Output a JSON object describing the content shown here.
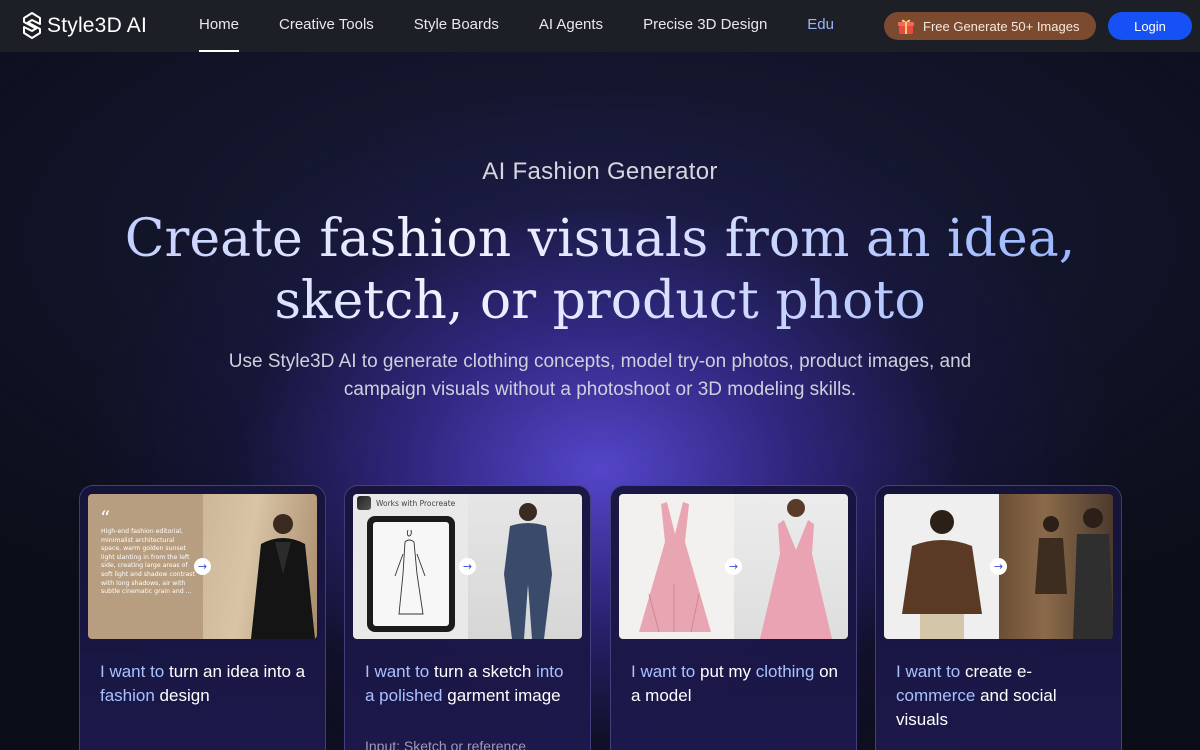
{
  "nav": {
    "logo_text": "Style3D AI",
    "links": [
      {
        "label": "Home",
        "active": true
      },
      {
        "label": "Creative Tools"
      },
      {
        "label": "Style Boards"
      },
      {
        "label": "AI Agents"
      },
      {
        "label": "Precise 3D Design"
      },
      {
        "label": "Edu"
      }
    ],
    "promo_label": "Free Generate 50+ Images",
    "promo_icon": "gift-icon",
    "login_label": "Login"
  },
  "hero": {
    "eyebrow": "AI Fashion Generator",
    "headline": "Create fashion visuals from an idea, sketch, or product photo",
    "subhead": "Use Style3D AI to generate clothing concepts, model try-on photos, product images, and campaign visuals without a photoshoot or 3D modeling skills."
  },
  "cards": [
    {
      "title_lead": "I want to",
      "title_rest_1": " turn an idea into a",
      "title_hl_2": " fashion",
      "title_rest_2": " design",
      "quote": "High-end fashion editorial, minimalist architectural space, warm golden sunset light slanting in from the left side, creating large areas of soft light and shadow contrast with long shadows, air with subtle cinematic grain and ...",
      "quote_mark": "“"
    },
    {
      "title_lead": "I want to",
      "title_rest_1": " turn a sketch",
      "title_hl_2": " into a polished",
      "title_rest_2": " garment image",
      "procreate_label": "Works with Procreate",
      "note": "Input: Sketch or reference"
    },
    {
      "title_lead": "I want to",
      "title_rest_1": " put my",
      "title_hl_2": " clothing",
      "title_rest_2": " on a model"
    },
    {
      "title_lead": "I want to",
      "title_rest_1": " create e-",
      "title_hl_2": " commerce",
      "title_rest_2": " and social visuals"
    }
  ],
  "colors": {
    "nav_bg": "#1d1f26",
    "promo_bg": "#7b4a2f",
    "login_bg": "#1551f5",
    "accent_text": "#a9c2ff"
  }
}
